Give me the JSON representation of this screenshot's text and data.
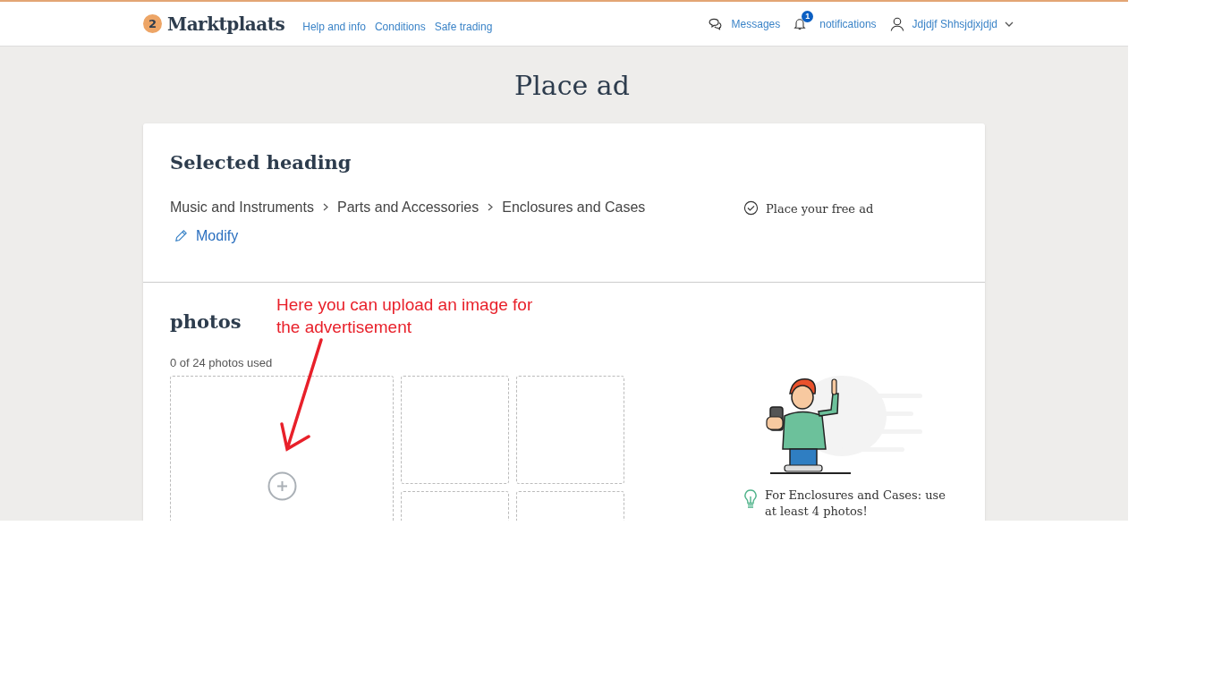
{
  "header": {
    "logo": {
      "mark": "2",
      "name": "Marktplaats"
    },
    "links": [
      "Help and info",
      "Conditions",
      "Safe trading"
    ],
    "messages": "Messages",
    "notifications": {
      "badge": "1",
      "label": "notifications"
    },
    "user": "Jdjdjf Shhsjdjxjdjd"
  },
  "page_title": "Place ad",
  "selected_heading": {
    "title": "Selected heading",
    "breadcrumb": [
      "Music and Instruments",
      "Parts and Accessories",
      "Enclosures and Cases"
    ],
    "modify": "Modify",
    "aside": "Place your free ad"
  },
  "photos": {
    "title": "photos",
    "annotation": "Here you can upload an image for the advertisement",
    "count": "0 of 24 photos used",
    "tip": "For Enclosures and Cases: use at least 4 photos!"
  }
}
